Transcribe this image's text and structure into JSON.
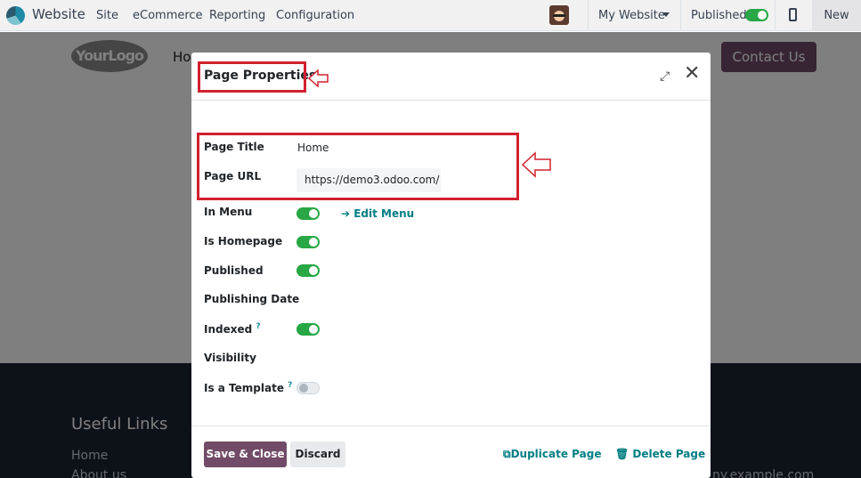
{
  "topbar": {
    "app_name": "Website",
    "menus": [
      "Site",
      "eCommerce",
      "Reporting",
      "Configuration"
    ],
    "website_selector": "My Website",
    "published_label": "Published",
    "published": true,
    "new_label": "New"
  },
  "site": {
    "logo_text": "YourLogo",
    "nav_home": "Ho",
    "contact_button": "Contact Us",
    "footer_heading": "Useful Links",
    "footer_links": [
      "Home",
      "About us"
    ],
    "footer_email": "ny.example.com"
  },
  "modal": {
    "title": "Page Properties",
    "fields": {
      "page_title": {
        "label": "Page Title",
        "value": "Home"
      },
      "page_url": {
        "label": "Page URL",
        "value": "https://demo3.odoo.com/"
      },
      "in_menu": {
        "label": "In Menu",
        "value": true,
        "action": "Edit Menu"
      },
      "is_homepage": {
        "label": "Is Homepage",
        "value": true
      },
      "published": {
        "label": "Published",
        "value": true
      },
      "publishing_date": {
        "label": "Publishing Date",
        "value": ""
      },
      "indexed": {
        "label": "Indexed",
        "help": "?",
        "value": true
      },
      "visibility": {
        "label": "Visibility",
        "value": ""
      },
      "is_template": {
        "label": "Is a Template",
        "help": "?",
        "value": false
      }
    },
    "buttons": {
      "save": "Save & Close",
      "discard": "Discard",
      "duplicate": "Duplicate Page",
      "delete": "Delete Page"
    }
  },
  "colors": {
    "brand": "#714b67",
    "link": "#017e84",
    "toggle_on": "#28a745",
    "annotation": "#d0212f"
  },
  "icons": [
    "expand-icon",
    "close-icon",
    "arrow-right-icon",
    "duplicate-icon",
    "trash-icon",
    "mobile-icon",
    "caret-down-icon"
  ]
}
